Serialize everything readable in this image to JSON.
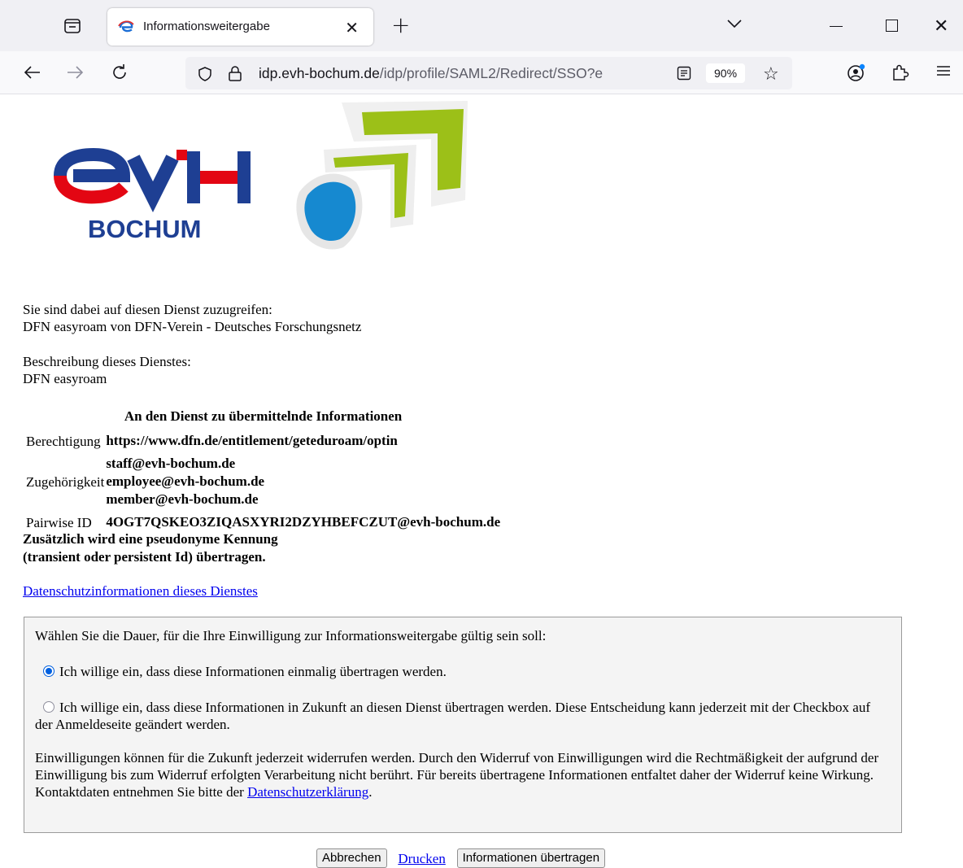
{
  "browser": {
    "tab_title": "Informationsweitergabe",
    "url_domain": "idp.evh-bochum.de",
    "url_path": "/idp/profile/SAML2/Redirect/SSO?e",
    "zoom": "90%"
  },
  "logo": {
    "text": "evH",
    "subtext": "BOCHUM"
  },
  "intro": {
    "line1": "Sie sind dabei auf diesen Dienst zuzugreifen:",
    "line2": "DFN easyroam von DFN-Verein - Deutsches Forschungsnetz"
  },
  "description": {
    "line1": "Beschreibung dieses Dienstes:",
    "line2": "DFN easyroam"
  },
  "attributes": {
    "heading": "An den Dienst zu übermittelnde Informationen",
    "rows": [
      {
        "label": "Berechtigung",
        "values": [
          "https://www.dfn.de/entitlement/geteduroam/optin"
        ]
      },
      {
        "label": "Zugehörigkeit",
        "values": [
          "staff@evh-bochum.de",
          "employee@evh-bochum.de",
          "member@evh-bochum.de"
        ]
      },
      {
        "label": "Pairwise ID",
        "values": [
          "4OGT7QSKEO3ZIQASXYRI2DZYHBEFCZUT@evh-bochum.de"
        ]
      }
    ],
    "note_line1": "Zusätzlich wird eine pseudonyme Kennung",
    "note_line2": "(transient oder persistent Id) übertragen."
  },
  "privacy_link": "Datenschutzinformationen dieses Dienstes",
  "consent": {
    "prompt": "Wählen Sie die Dauer, für die Ihre Einwilligung zur Informationsweitergabe gültig sein soll:",
    "option_once": "Ich willige ein, dass diese Informationen einmalig übertragen werden.",
    "option_future": "Ich willige ein, dass diese Informationen in Zukunft an diesen Dienst übertragen werden. Diese Entscheidung kann jederzeit mit der Checkbox auf der Anmeldeseite geändert werden.",
    "selected": "once",
    "revocation_text": "Einwilligungen können für die Zukunft jederzeit widerrufen werden. Durch den Widerruf von Einwilligungen wird die Rechtmäßigkeit der aufgrund der Einwilligung bis zum Widerruf erfolgten Verarbeitung nicht berührt. Für bereits übertragene Informationen entfaltet daher der Widerruf keine Wirkung. Kontaktdaten entnehmen Sie bitte der",
    "revocation_link": "Datenschutzerklärung",
    "revocation_end": "."
  },
  "buttons": {
    "cancel": "Abbrechen",
    "print": "Drucken",
    "submit": "Informationen übertragen"
  },
  "colors": {
    "logo_blue": "#1e3f93",
    "logo_red": "#e30613",
    "logo_cyan": "#1689d0",
    "logo_green": "#9cc018",
    "link": "#0000ee",
    "radio_selected": "#0060df"
  }
}
